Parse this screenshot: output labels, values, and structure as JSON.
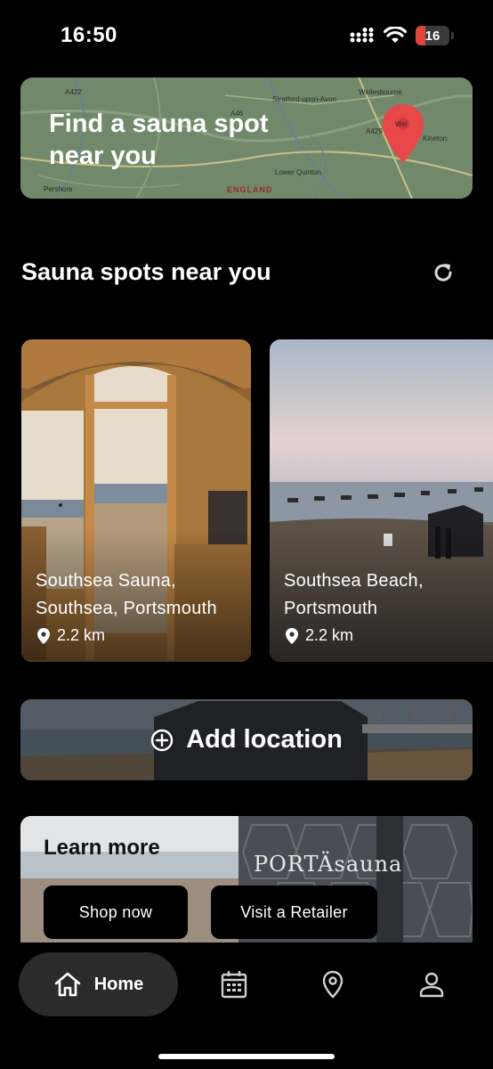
{
  "status_bar": {
    "time": "16:50",
    "battery_level": "16",
    "battery_color": "#e0453a"
  },
  "map_banner": {
    "title": "Find a sauna spot near you",
    "labels": {
      "stratford": "Stratford-upon-Avon",
      "wellesbourne": "Wellesbourne",
      "kineton": "Kineton",
      "lower_quinton": "Lower Quinton",
      "pershore": "Pershore",
      "england": "ENGLAND",
      "road_a1": "A422",
      "road_a2": "A429",
      "road_a3": "A46",
      "pin_town": "Wel"
    },
    "pin_icon": "map-pin-icon",
    "pin_color": "#e8484a"
  },
  "section": {
    "title": "Sauna spots near you",
    "refresh_icon": "refresh-icon"
  },
  "spots": [
    {
      "name": "Southsea Sauna, Southsea, Portsmouth",
      "distance": "2.2 km"
    },
    {
      "name": "Southsea Beach, Portsmouth",
      "distance": "2.2 km"
    }
  ],
  "add_location": {
    "label": "Add location",
    "icon": "plus-circle-icon"
  },
  "learn_more": {
    "title": "Learn more",
    "brand": "PORTÄsauna",
    "shop_button": "Shop now",
    "retailer_button": "Visit a Retailer"
  },
  "nav": {
    "home_label": "Home",
    "items": [
      "home-icon",
      "calendar-icon",
      "location-icon",
      "profile-icon"
    ]
  }
}
